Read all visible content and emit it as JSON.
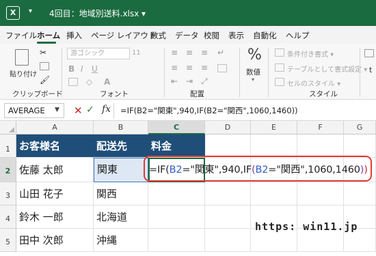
{
  "titlebar": {
    "app_icon": "X",
    "qat_arrow": "▾",
    "title": "4回目：地域別送料.xlsx ▾"
  },
  "menu": {
    "items": [
      "ファイル",
      "ホーム",
      "挿入",
      "ページ レイアウト",
      "数式",
      "データ",
      "校閲",
      "表示",
      "自動化",
      "ヘルプ"
    ],
    "active": "ホーム"
  },
  "ribbon": {
    "clipboard": {
      "paste_label": "貼り付け",
      "group_label": "クリップボード"
    },
    "font": {
      "font_name": "游ゴシック",
      "font_size": "11",
      "group_label": "フォント"
    },
    "alignment": {
      "group_label": "配置"
    },
    "number": {
      "icon": "%",
      "label": "数値"
    },
    "styles": {
      "items": [
        "条件付き書式 ▾",
        "テーブルとして書式設定 ▾",
        "セルのスタイル ▾"
      ],
      "group_label": "スタイル"
    },
    "cells_partial": "t"
  },
  "formula_bar": {
    "name_box": "AVERAGE",
    "cancel_icon": "✕",
    "enter_icon": "✓",
    "fx_label": "fx",
    "formula": "=IF(B2=\"関東\",940,IF(B2=\"関西\",1060,1460))"
  },
  "grid": {
    "columns": [
      "A",
      "B",
      "C",
      "D",
      "E",
      "F",
      "G"
    ],
    "rows": [
      "1",
      "2",
      "3",
      "4",
      "5"
    ],
    "selected_column": "C",
    "selected_row": "2",
    "header_row": [
      "お客様名",
      "配送先",
      "料金"
    ],
    "data_rows": [
      [
        "佐藤 太郎",
        "関東"
      ],
      [
        "山田 花子",
        "関西"
      ],
      [
        "鈴木 一郎",
        "北海道"
      ],
      [
        "田中 次郎",
        "沖縄"
      ]
    ],
    "edit_formula": {
      "p1": "=IF(",
      "r1": "B2",
      "p2": "=\"関東\",940,IF",
      "p3": "(",
      "r2": "B2",
      "p4": "=\"関西\",1060,1460",
      "p5": ")",
      "p6": ")"
    }
  },
  "watermark": "https: win11.jp",
  "colors": {
    "title_green": "#1b6b40",
    "header_fill": "#1f4e79",
    "callout_red": "#e53935",
    "ref_blue": "#2f5fc4"
  }
}
